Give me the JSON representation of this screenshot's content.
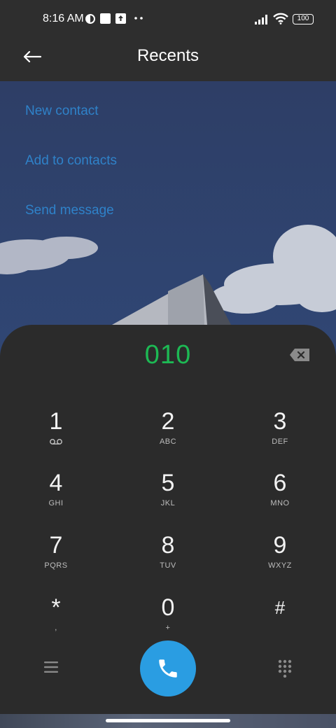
{
  "status_bar": {
    "time": "8:16 AM",
    "battery": "100",
    "icons": [
      "vpn-icon",
      "square-notification-icon",
      "upload-icon",
      "more-dots-icon",
      "signal-icon",
      "wifi-icon",
      "battery-icon"
    ]
  },
  "header": {
    "title": "Recents",
    "back_icon": "arrow-left-icon"
  },
  "actions": [
    {
      "label": "New contact"
    },
    {
      "label": "Add to contacts"
    },
    {
      "label": "Send message"
    }
  ],
  "dialer": {
    "number": "010",
    "number_color": "#1db954",
    "keys": [
      {
        "digit": "1",
        "letters": ""
      },
      {
        "digit": "2",
        "letters": "ABC"
      },
      {
        "digit": "3",
        "letters": "DEF"
      },
      {
        "digit": "4",
        "letters": "GHI"
      },
      {
        "digit": "5",
        "letters": "JKL"
      },
      {
        "digit": "6",
        "letters": "MNO"
      },
      {
        "digit": "7",
        "letters": "PQRS"
      },
      {
        "digit": "8",
        "letters": "TUV"
      },
      {
        "digit": "9",
        "letters": "WXYZ"
      },
      {
        "digit": "*",
        "letters": ","
      },
      {
        "digit": "0",
        "letters": "+"
      },
      {
        "digit": "#",
        "letters": ""
      }
    ]
  },
  "bottom_bar": {
    "call_color": "#2a9de2"
  },
  "colors": {
    "accent_link": "#2f82c9",
    "sheet_bg": "#2b2b2b"
  }
}
